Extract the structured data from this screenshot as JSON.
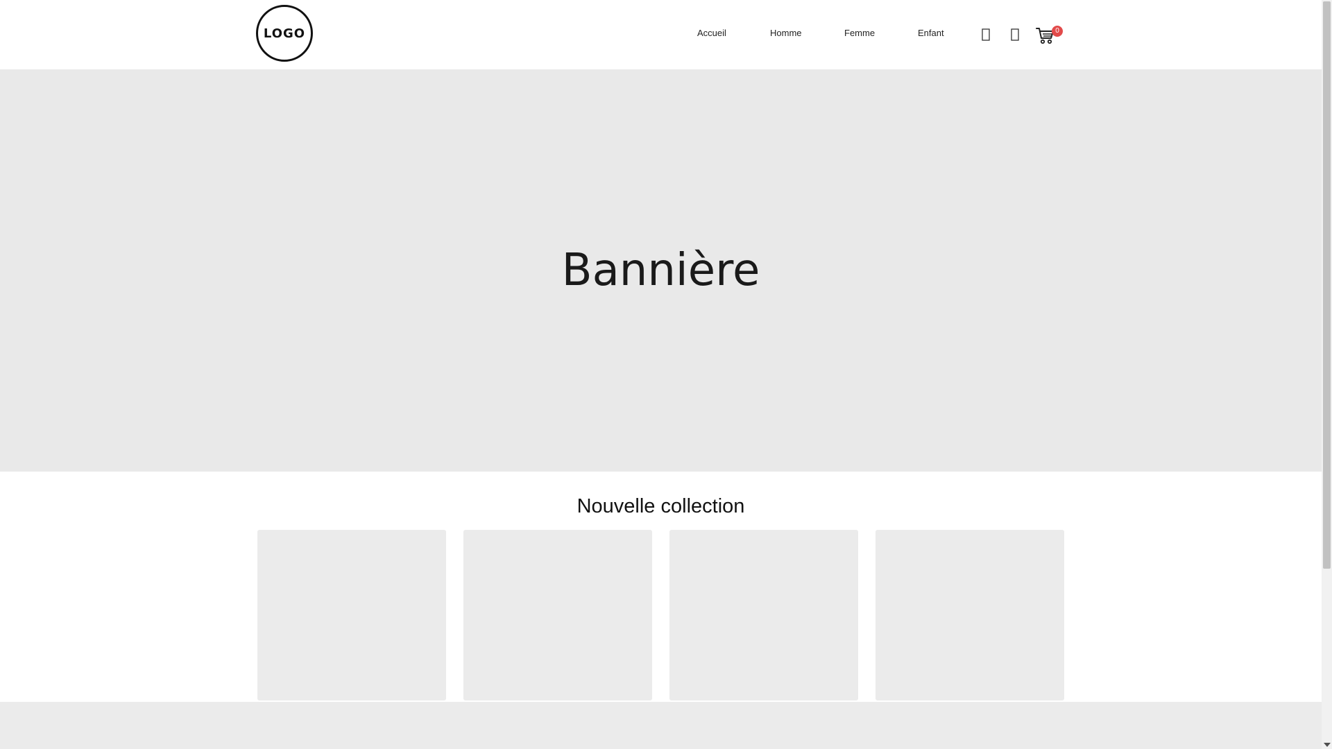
{
  "header": {
    "logo_text": "LOGO",
    "nav": [
      {
        "label": "Accueil"
      },
      {
        "label": "Homme"
      },
      {
        "label": "Femme"
      },
      {
        "label": "Enfant"
      }
    ],
    "icons": [
      "search-icon",
      "user-icon",
      "cart-icon"
    ],
    "cart_count": "0"
  },
  "banner": {
    "title": "Bannière"
  },
  "collection": {
    "title": "Nouvelle collection",
    "card_count": 4
  },
  "colors": {
    "banner_bg": "#e9e9e9",
    "card_bg": "#ebebeb",
    "badge": "#e24a4a"
  }
}
